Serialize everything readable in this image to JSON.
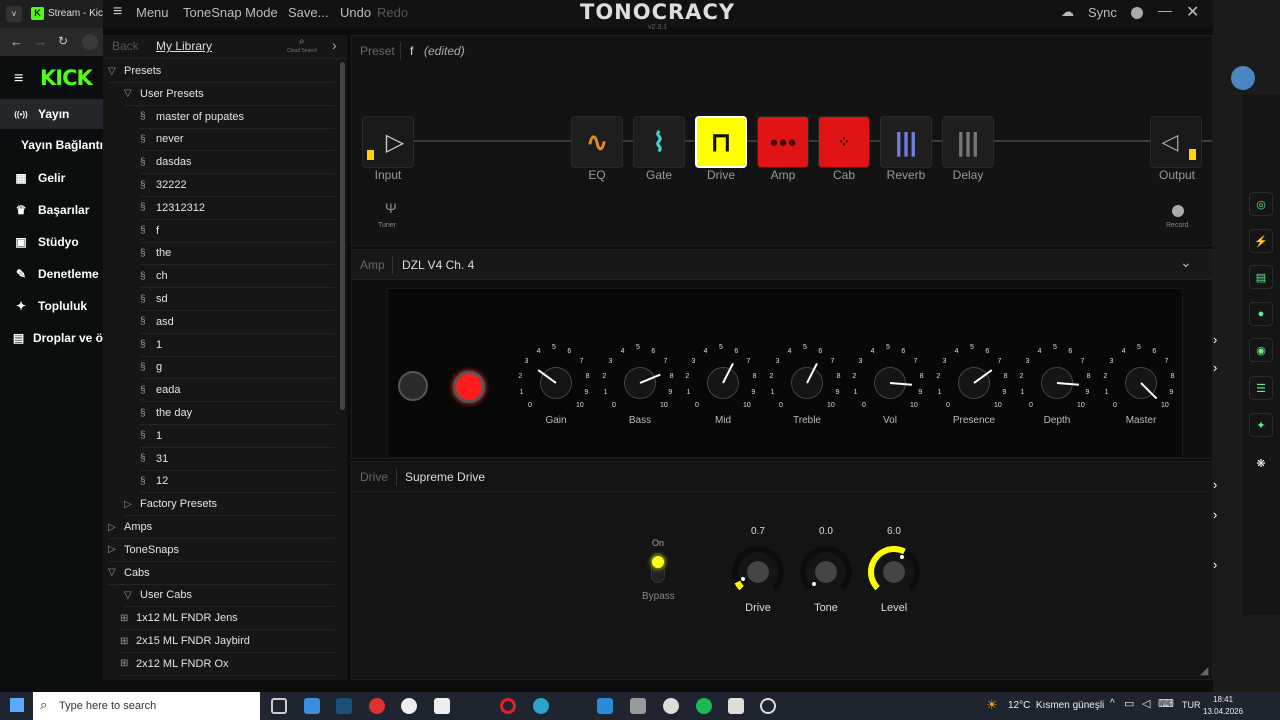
{
  "browser": {
    "tab_title": "Stream - Kick D",
    "tab_icon": "kick-favicon"
  },
  "kick": {
    "logo": "KICK",
    "nav": [
      {
        "icon": "broadcast-icon",
        "label": "Yayın",
        "active": true
      },
      {
        "icon": "",
        "label": "Yayın Bağlantı"
      },
      {
        "icon": "chart-icon",
        "label": "Gelir"
      },
      {
        "icon": "trophy-icon",
        "label": "Başarılar"
      },
      {
        "icon": "studio-icon",
        "label": "Stüdyo"
      },
      {
        "icon": "wrench-icon",
        "label": "Denetleme"
      },
      {
        "icon": "people-icon",
        "label": "Topluluk"
      },
      {
        "icon": "gift-icon",
        "label": "Droplar ve ö"
      }
    ]
  },
  "app": {
    "menu_label": "Menu",
    "tonesnap_mode": "ToneSnap Mode",
    "save": "Save...",
    "undo": "Undo",
    "redo": "Redo",
    "logo": "TONOCRACY",
    "version": "v2.3.1",
    "sync": "Sync"
  },
  "library": {
    "back": "Back",
    "title": "My Library",
    "cloud_search": "Cloud Search",
    "presets": "Presets",
    "user_presets": "User Presets",
    "user_preset_items": [
      "master of pupates",
      "never",
      "dasdas",
      "32222",
      "12312312",
      "f",
      "the",
      "ch",
      "sd",
      "asd",
      "1",
      "g",
      "eada",
      "the day",
      "1",
      "31",
      "12"
    ],
    "factory_presets": "Factory Presets",
    "amps": "Amps",
    "tonesnaps": "ToneSnaps",
    "cabs": "Cabs",
    "user_cabs": "User Cabs",
    "cab_items": [
      "1x12 ML FNDR Jens",
      "2x15 ML FNDR Jaybird",
      "2x12 ML FNDR Ox"
    ]
  },
  "preset": {
    "label": "Preset",
    "name": "f",
    "edited": "(edited)"
  },
  "chain": {
    "input": "Input",
    "output": "Output",
    "tuner": "Tuner",
    "record": "Record",
    "blocks": [
      {
        "label": "EQ",
        "icon": "eq-icon",
        "color": "#e08a1c"
      },
      {
        "label": "Gate",
        "icon": "gate-icon",
        "color": "#3fd2d2"
      },
      {
        "label": "Drive",
        "icon": "drive-icon",
        "color": "#ffff00"
      },
      {
        "label": "Amp",
        "icon": "amp-icon",
        "color": "#e01414"
      },
      {
        "label": "Cab",
        "icon": "cab-icon",
        "color": "#e01414"
      },
      {
        "label": "Reverb",
        "icon": "reverb-icon",
        "color": "#6f7fe0"
      },
      {
        "label": "Delay",
        "icon": "delay-icon",
        "color": "#777777"
      }
    ]
  },
  "amp": {
    "section_label": "Amp",
    "model": "DZL V4 Ch. 4",
    "knobs": [
      {
        "label": "Gain",
        "value": 3
      },
      {
        "label": "Bass",
        "value": 7.5
      },
      {
        "label": "Mid",
        "value": 6
      },
      {
        "label": "Treble",
        "value": 6
      },
      {
        "label": "Vol",
        "value": 8.5
      },
      {
        "label": "Presence",
        "value": 7
      },
      {
        "label": "Depth",
        "value": 8.5
      },
      {
        "label": "Master",
        "value": 10
      }
    ],
    "scale": [
      "0",
      "1",
      "2",
      "3",
      "4",
      "5",
      "6",
      "7",
      "8",
      "9",
      "10"
    ]
  },
  "drive": {
    "section_label": "Drive",
    "model": "Supreme Drive",
    "on": "On",
    "bypass": "Bypass",
    "knobs": [
      {
        "label": "Drive",
        "value": "0.7",
        "level": 0.07
      },
      {
        "label": "Tone",
        "value": "0.0",
        "level": 0.0
      },
      {
        "label": "Level",
        "value": "6.0",
        "level": 0.6
      }
    ]
  },
  "taskbar": {
    "search_placeholder": "Type here to search",
    "weather": "12°C  Kısmen güneşli",
    "lang": "TUR",
    "time": "18:41",
    "date": "13.04.2026"
  }
}
